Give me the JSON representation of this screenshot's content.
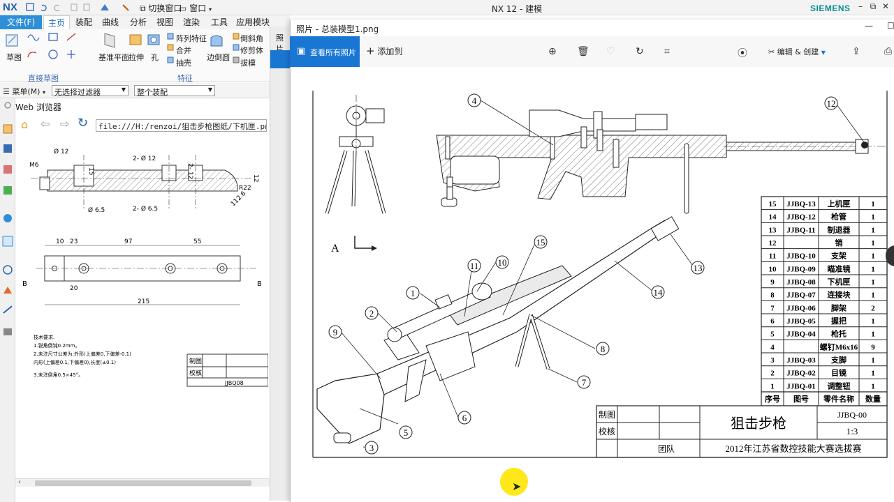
{
  "nx": {
    "logo": "NX",
    "title": "NX 12 - 建模",
    "brand": "SIEMENS",
    "switch_window": "切换窗口",
    "window_menu": "窗口",
    "tabs": [
      "文件(F)",
      "主页",
      "装配",
      "曲线",
      "分析",
      "视图",
      "渲染",
      "工具",
      "应用模块"
    ],
    "ribbon": {
      "sketch": "草图",
      "direct_sketch_group": "直接草图",
      "datum_plane": "基准平面",
      "extrude": "拉伸",
      "hole": "孔",
      "pattern_feature": "阵列特征",
      "unite": "合并",
      "shell": "抽壳",
      "edge_blend": "边倒圆",
      "chamfer": "倒斜角",
      "trim_body": "修剪体",
      "draft": "拔模",
      "feature_group": "特征"
    },
    "filter_bar": {
      "menu": "菜单(M)",
      "selection_filter": "无选择过滤器",
      "scope": "整个装配"
    },
    "web_browser": {
      "title": "Web 浏览器",
      "address": "file:///H:/renzoi/狙击步枪图纸/下机匣.png",
      "drawing": {
        "dims": [
          "Ø 12",
          "2- Ø 12",
          "15",
          "2- 12",
          "12",
          "M6",
          "Ø 6.5",
          "2- Ø 6.5",
          "R22",
          "112.6",
          "10",
          "23",
          "97",
          "55",
          "20",
          "215",
          "B",
          "B"
        ],
        "notes": [
          "技术要求.",
          "1.锐角倒钝0.2mm。",
          "2.未注尺寸公差为:外形(上偏差0,下偏差-0.1)",
          "内形(上偏差0.1,下偏差0),长度(±0.1)",
          "3.未注倒角0.5×45°。"
        ],
        "title_block": {
          "draw": "制图",
          "check": "校核",
          "code": "JJBQ08"
        }
      }
    }
  },
  "photos": {
    "title": "照片 - 总装模型1.png",
    "view_all": "查看所有照片",
    "add_to": "添加到",
    "edit_create": "编辑 & 创建",
    "behind_window_label": "照片"
  },
  "drawing": {
    "view_label": "A",
    "balloons": [
      "1",
      "2",
      "3",
      "4",
      "5",
      "6",
      "7",
      "8",
      "9",
      "10",
      "11",
      "12",
      "13",
      "14",
      "15"
    ],
    "bom_header": {
      "seq": "序号",
      "code": "图号",
      "name": "零件名称",
      "qty": "数量"
    },
    "bom": [
      {
        "seq": "15",
        "code": "JJBQ-13",
        "name": "上机匣",
        "qty": "1"
      },
      {
        "seq": "14",
        "code": "JJBQ-12",
        "name": "枪管",
        "qty": "1"
      },
      {
        "seq": "13",
        "code": "JJBQ-11",
        "name": "制退器",
        "qty": "1"
      },
      {
        "seq": "12",
        "code": "",
        "name": "销",
        "qty": "1"
      },
      {
        "seq": "11",
        "code": "JJBQ-10",
        "name": "支架",
        "qty": "1"
      },
      {
        "seq": "10",
        "code": "JJBQ-09",
        "name": "瞄准镜",
        "qty": "1"
      },
      {
        "seq": "9",
        "code": "JJBQ-08",
        "name": "下机匣",
        "qty": "1"
      },
      {
        "seq": "8",
        "code": "JJBQ-07",
        "name": "连接块",
        "qty": "1"
      },
      {
        "seq": "7",
        "code": "JJBQ-06",
        "name": "脚架",
        "qty": "2"
      },
      {
        "seq": "6",
        "code": "JJBQ-05",
        "name": "握把",
        "qty": "1"
      },
      {
        "seq": "5",
        "code": "JJBQ-04",
        "name": "枪托",
        "qty": "1"
      },
      {
        "seq": "4",
        "code": "",
        "name": "螺钉M6x16",
        "qty": "9"
      },
      {
        "seq": "3",
        "code": "JJBQ-03",
        "name": "支脚",
        "qty": "1"
      },
      {
        "seq": "2",
        "code": "JJBQ-02",
        "name": "目镜",
        "qty": "1"
      },
      {
        "seq": "1",
        "code": "JJBQ-01",
        "name": "调整钮",
        "qty": "1"
      }
    ],
    "title_block": {
      "draw": "制图",
      "check": "校核",
      "team": "团队",
      "name": "狙击步枪",
      "code": "JJBQ-00",
      "scale": "1:3",
      "event": "2012年江苏省数控技能大赛选拔赛"
    }
  },
  "colors": {
    "nx_blue": "#2e8fd8",
    "siemens_teal": "#0b8f93",
    "photos_blue": "#1976d2",
    "cursor_yellow": "#ffe600"
  }
}
